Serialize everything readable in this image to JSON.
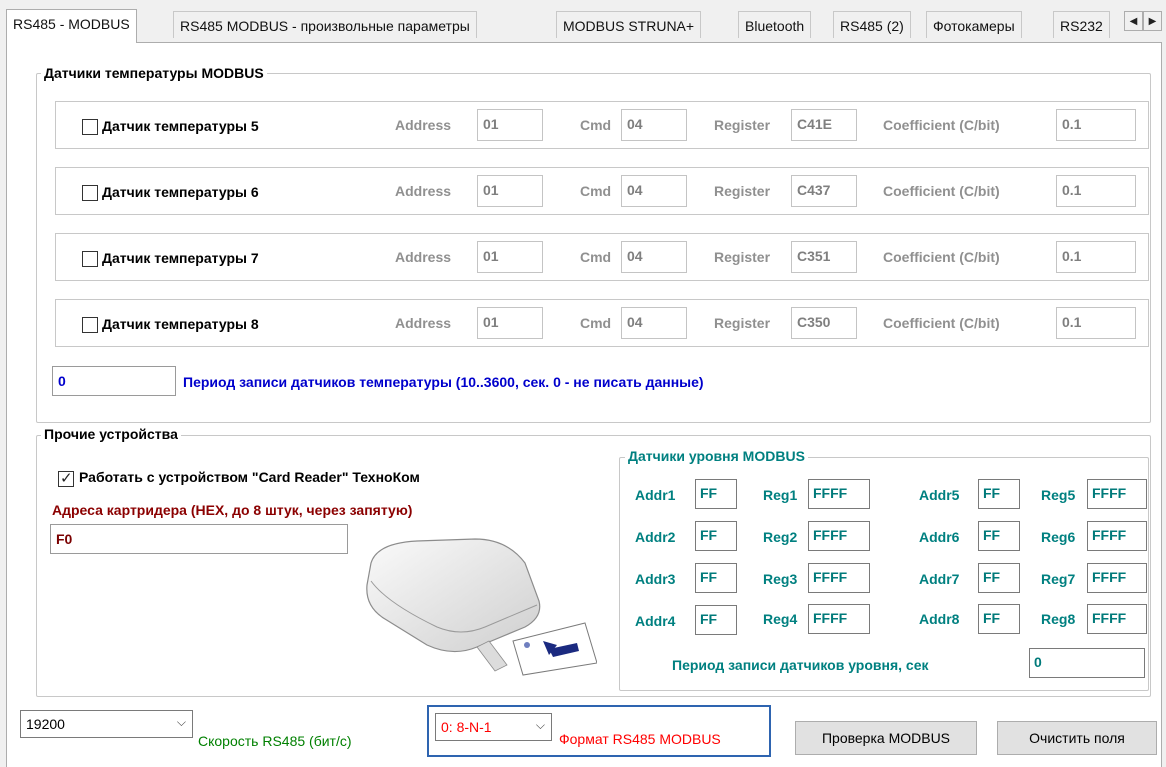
{
  "tabs": [
    "RS485 - MODBUS",
    "RS485 MODBUS - произвольные параметры",
    "MODBUS STRUNA+",
    "Bluetooth",
    "RS485 (2)",
    "Фотокамеры",
    "RS232"
  ],
  "temp_group": {
    "title": "Датчики температуры MODBUS",
    "address_label": "Address",
    "cmd_label": "Cmd",
    "register_label": "Register",
    "coeff_label": "Coefficient (C/bit)",
    "sensors": [
      {
        "label": "Датчик температуры 5",
        "checked": false,
        "address": "01",
        "cmd": "04",
        "register": "C41E",
        "coeff": "0.1"
      },
      {
        "label": "Датчик температуры 6",
        "checked": false,
        "address": "01",
        "cmd": "04",
        "register": "C437",
        "coeff": "0.1"
      },
      {
        "label": "Датчик температуры 7",
        "checked": false,
        "address": "01",
        "cmd": "04",
        "register": "C351",
        "coeff": "0.1"
      },
      {
        "label": "Датчик температуры 8",
        "checked": false,
        "address": "01",
        "cmd": "04",
        "register": "C350",
        "coeff": "0.1"
      }
    ],
    "period_value": "0",
    "period_label": "Период записи датчиков температуры (10..3600, сек. 0 - не писать данные)"
  },
  "other_group": {
    "title": "Прочие устройства",
    "card_reader_label": "Работать с устройством \"Card Reader\" ТехноКом",
    "card_reader_checked": true,
    "card_address_label": "Адреса картридера (HEX, до 8 штук, через запятую)",
    "card_address_value": "F0"
  },
  "level_group": {
    "title": "Датчики уровня MODBUS",
    "sensors": [
      {
        "addr_label": "Addr1",
        "addr": "FF",
        "reg_label": "Reg1",
        "reg": "FFFF"
      },
      {
        "addr_label": "Addr2",
        "addr": "FF",
        "reg_label": "Reg2",
        "reg": "FFFF"
      },
      {
        "addr_label": "Addr3",
        "addr": "FF",
        "reg_label": "Reg3",
        "reg": "FFFF"
      },
      {
        "addr_label": "Addr4",
        "addr": "FF",
        "reg_label": "Reg4",
        "reg": "FFFF"
      },
      {
        "addr_label": "Addr5",
        "addr": "FF",
        "reg_label": "Reg5",
        "reg": "FFFF"
      },
      {
        "addr_label": "Addr6",
        "addr": "FF",
        "reg_label": "Reg6",
        "reg": "FFFF"
      },
      {
        "addr_label": "Addr7",
        "addr": "FF",
        "reg_label": "Reg7",
        "reg": "FFFF"
      },
      {
        "addr_label": "Addr8",
        "addr": "FF",
        "reg_label": "Reg8",
        "reg": "FFFF"
      }
    ],
    "period_label": "Период записи датчиков уровня, сек",
    "period_value": "0"
  },
  "bottom": {
    "speed_value": "19200",
    "speed_label": "Скорость RS485 (бит/с)",
    "format_value": "0:  8-N-1",
    "format_label": "Формат RS485 MODBUS",
    "check_button": "Проверка MODBUS",
    "clear_button": "Очистить поля"
  },
  "colors": {
    "blue": "#0000cc",
    "dark_red": "#8b0000",
    "teal": "#008080",
    "green": "#008000",
    "red": "#ff0000",
    "highlight": "#2e64b0"
  },
  "icons": [
    "checkbox",
    "chevron-down-icon",
    "arrow-left-icon",
    "arrow-right-icon",
    "card-reader-illustration"
  ]
}
